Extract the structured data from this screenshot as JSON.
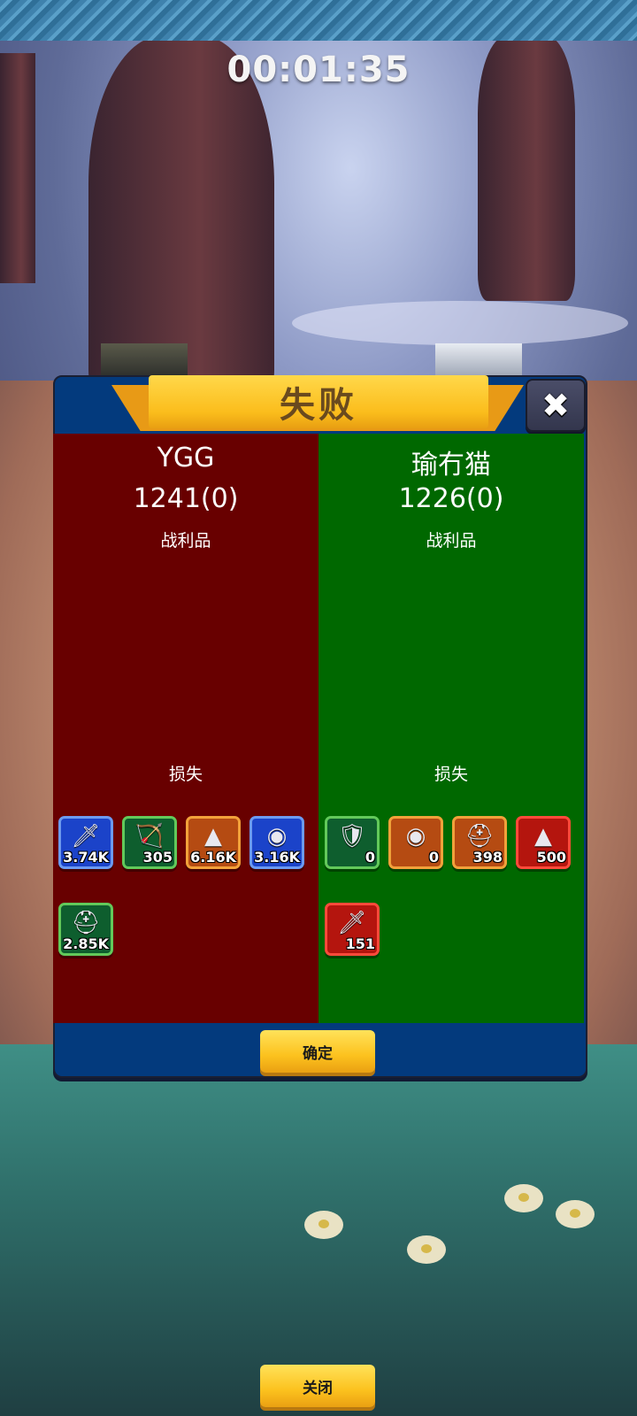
{
  "timer": "00:01:35",
  "dialog": {
    "title": "失败",
    "close_icon": "close-icon",
    "confirm_label": "确定"
  },
  "left": {
    "name": "YGG",
    "score": "1241(0)",
    "loot_label": "战利品",
    "loss_label": "损失",
    "color": "#680000",
    "units": [
      {
        "icon": "sword-icon",
        "frame": "blue",
        "count": "3.74K"
      },
      {
        "icon": "bow-icon",
        "frame": "green",
        "count": "305"
      },
      {
        "icon": "wizard-hat-icon",
        "frame": "orange",
        "count": "6.16K"
      },
      {
        "icon": "hooded-helmet-icon",
        "frame": "blue",
        "count": "3.16K"
      },
      {
        "icon": "knight-helmet-icon",
        "frame": "green",
        "count": "2.85K"
      }
    ]
  },
  "right": {
    "name": "瑜冇猫",
    "score": "1226(0)",
    "loot_label": "战利品",
    "loss_label": "损失",
    "color": "#006800",
    "units": [
      {
        "icon": "shield-hearts-icon",
        "frame": "green",
        "count": "0"
      },
      {
        "icon": "hooded-helmet-icon",
        "frame": "orange",
        "count": "0"
      },
      {
        "icon": "knight-helmet-icon",
        "frame": "orange",
        "count": "398"
      },
      {
        "icon": "wizard-hat-icon",
        "frame": "red",
        "count": "500"
      },
      {
        "icon": "sword-icon",
        "frame": "red",
        "count": "151"
      }
    ]
  },
  "footer": {
    "close_label": "关闭"
  }
}
